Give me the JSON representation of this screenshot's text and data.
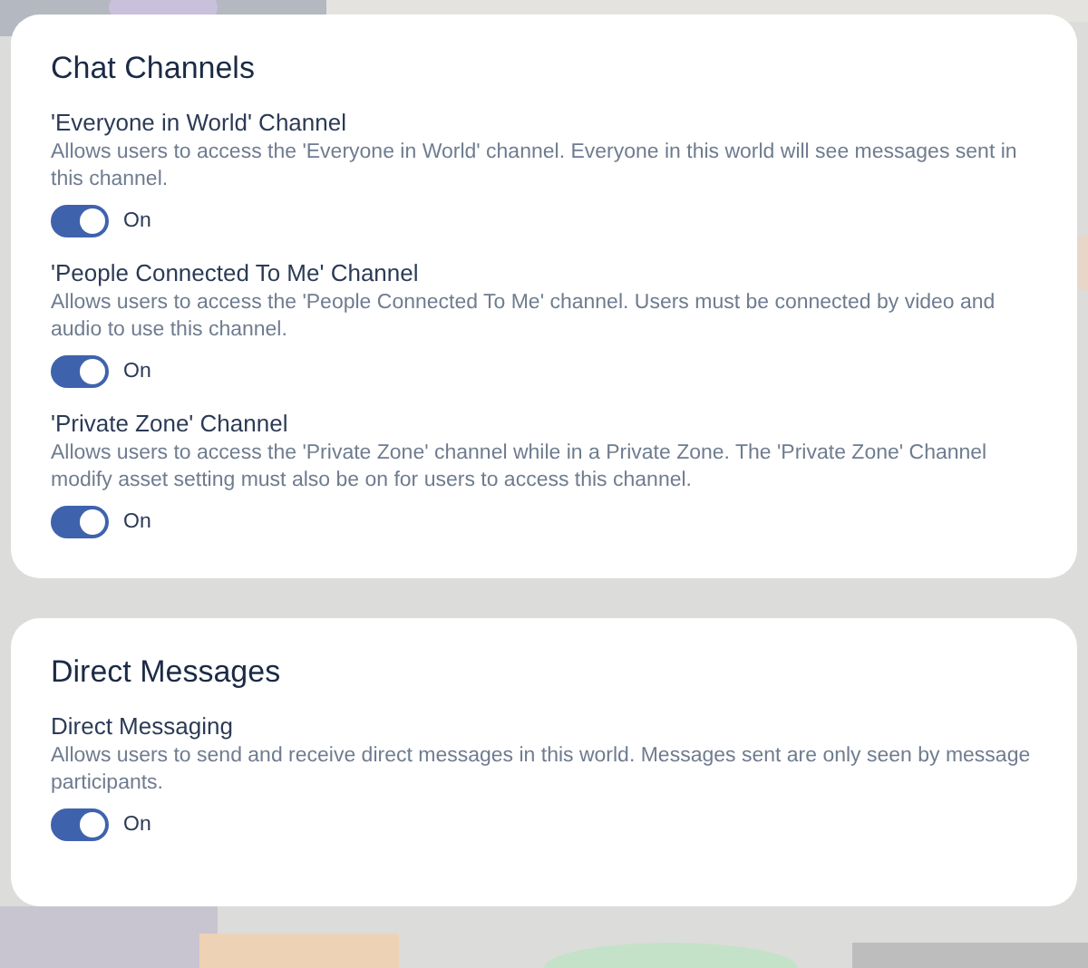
{
  "sections": [
    {
      "title": "Chat Channels",
      "settings": [
        {
          "label": "'Everyone in World' Channel",
          "description": "Allows users to access the 'Everyone in World' channel. Everyone in this world will see messages sent in this channel.",
          "on": true,
          "state_label": "On"
        },
        {
          "label": "'People Connected To Me' Channel",
          "description": "Allows users to access the 'People Connected To Me' channel. Users must be connected by video and audio to use this channel.",
          "on": true,
          "state_label": "On"
        },
        {
          "label": "'Private Zone' Channel",
          "description": "Allows users to access the 'Private Zone' channel while in a Private Zone. The 'Private Zone' Channel modify asset setting must also be on for users to access this channel.",
          "on": true,
          "state_label": "On"
        }
      ]
    },
    {
      "title": "Direct Messages",
      "settings": [
        {
          "label": "Direct Messaging",
          "description": "Allows users to send and receive direct messages in this world. Messages sent are only seen by message participants.",
          "on": true,
          "state_label": "On"
        }
      ]
    }
  ]
}
